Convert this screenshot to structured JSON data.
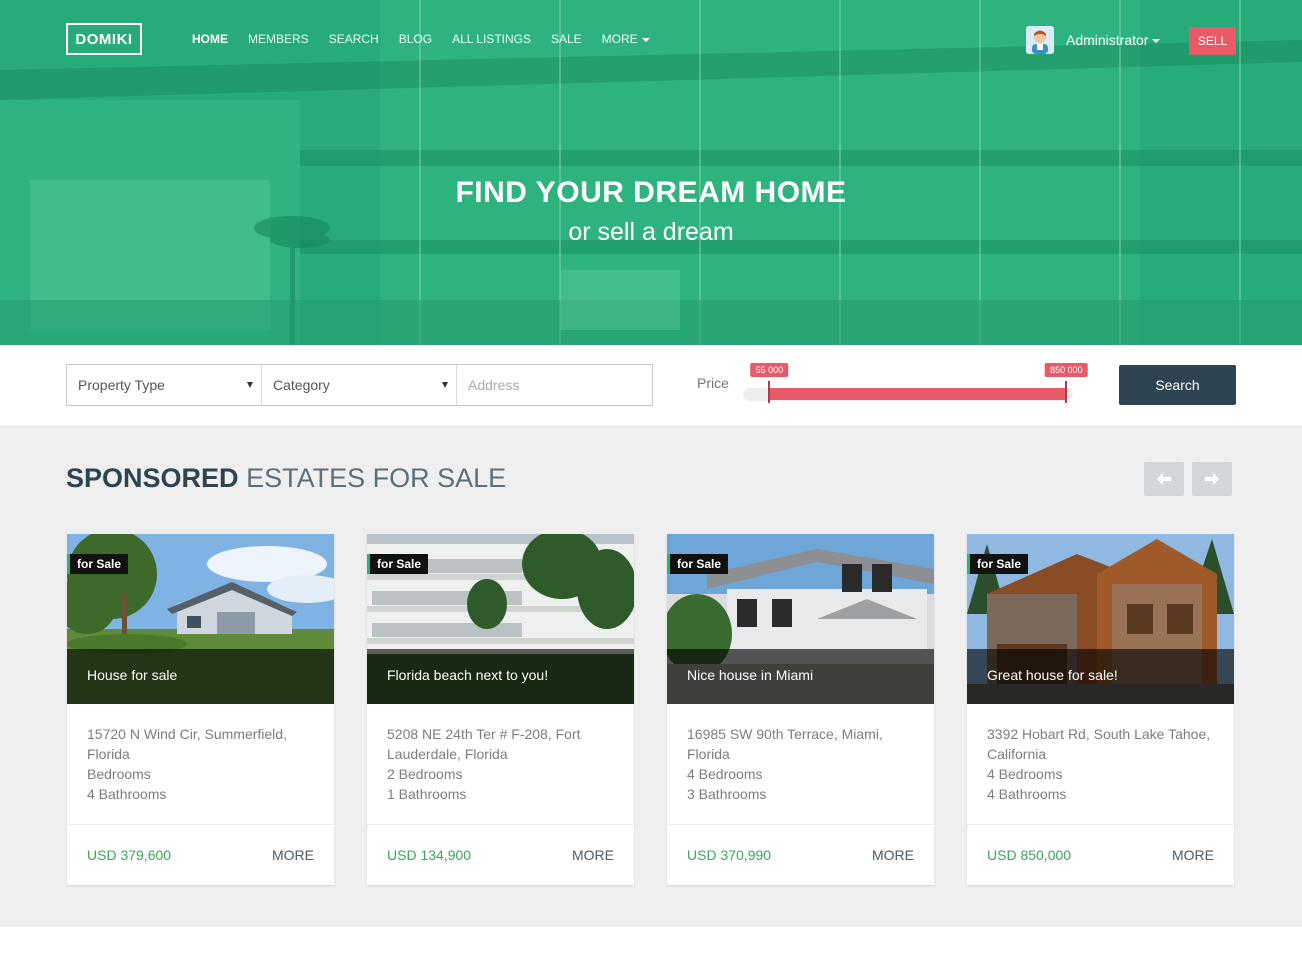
{
  "brand": {
    "logo": "DOMIKI"
  },
  "nav": {
    "items": [
      "HOME",
      "MEMBERS",
      "SEARCH",
      "BLOG",
      "ALL LISTINGS",
      "SALE",
      "MORE"
    ],
    "active": "HOME"
  },
  "user": {
    "name": "Administrator",
    "sell_label": "SELL"
  },
  "hero": {
    "title": "FIND YOUR DREAM HOME",
    "subtitle": "or sell a dream"
  },
  "search": {
    "property_type": "Property Type",
    "category": "Category",
    "address_placeholder": "Address",
    "price_label": "Price",
    "price_min": "55 000",
    "price_max": "850 000",
    "range": {
      "min_fraction": 0.08,
      "max_fraction": 0.98
    },
    "button_label": "Search"
  },
  "section": {
    "title_strong": "SPONSORED",
    "title_light": "ESTATES FOR SALE"
  },
  "listings": [
    {
      "badge": "for Sale",
      "title": "House for sale",
      "address": "15720 N Wind Cir, Summerfield, Florida",
      "bedrooms": "Bedrooms",
      "bathrooms": "4 Bathrooms",
      "price": "USD 379,600",
      "more": "MORE"
    },
    {
      "badge": "for Sale",
      "title": "Florida beach next to you!",
      "address": "5208 NE 24th Ter # F-208, Fort Lauderdale, Florida",
      "bedrooms": "2 Bedrooms",
      "bathrooms": "1 Bathrooms",
      "price": "USD 134,900",
      "more": "MORE"
    },
    {
      "badge": "for Sale",
      "title": "Nice house in Miami",
      "address": "16985 SW 90th Terrace, Miami, Florida",
      "bedrooms": "4 Bedrooms",
      "bathrooms": "3 Bathrooms",
      "price": "USD 370,990",
      "more": "MORE"
    },
    {
      "badge": "for Sale",
      "title": "Great house for sale!",
      "address": "3392 Hobart Rd, South Lake Tahoe, California",
      "bedrooms": "4 Bedrooms",
      "bathrooms": "4 Bathrooms",
      "price": "USD 850,000",
      "more": "MORE"
    }
  ],
  "colors": {
    "hero_green": "#2db47e",
    "accent_red": "#e85a68",
    "dark_blue": "#2e4453",
    "price_green": "#3aa55b"
  }
}
